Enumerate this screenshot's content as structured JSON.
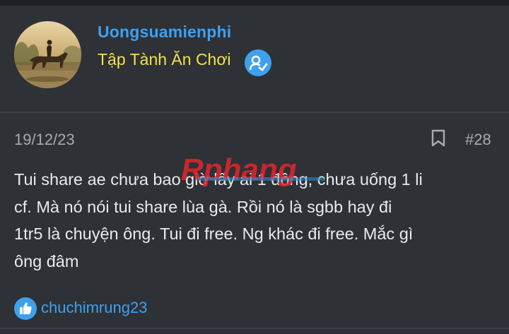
{
  "post": {
    "author": {
      "username": "Uongsuamienphi",
      "user_title": "Tập Tành Ăn Chơi",
      "avatar_icon": "avatar-photo",
      "badge_icon": "verified-badge-icon"
    },
    "date": "19/12/23",
    "post_number": "#28",
    "bookmark_icon": "bookmark-icon",
    "body_lines": [
      "Tui share ae chưa bao giờ lấy ai 1 đồng, chưa uống 1 li",
      "cf. Mà nó nói tui share lùa gà. Rồi nó là sgbb hay đi",
      "1tr5 là chuyện ông. Tui đi free. Ng khác đi free. Mắc gì",
      "ông đâm"
    ],
    "reactions": {
      "icon": "like-icon",
      "users": "chuchimrung23"
    }
  },
  "watermark": "Rphang",
  "colors": {
    "background": "#2e3135",
    "username": "#3ea1f0",
    "user_title": "#f1e34a",
    "text": "#e9eaec",
    "meta": "#a8abb0",
    "watermark_red": "#e2262c",
    "watermark_blue": "#2b8fd6"
  }
}
